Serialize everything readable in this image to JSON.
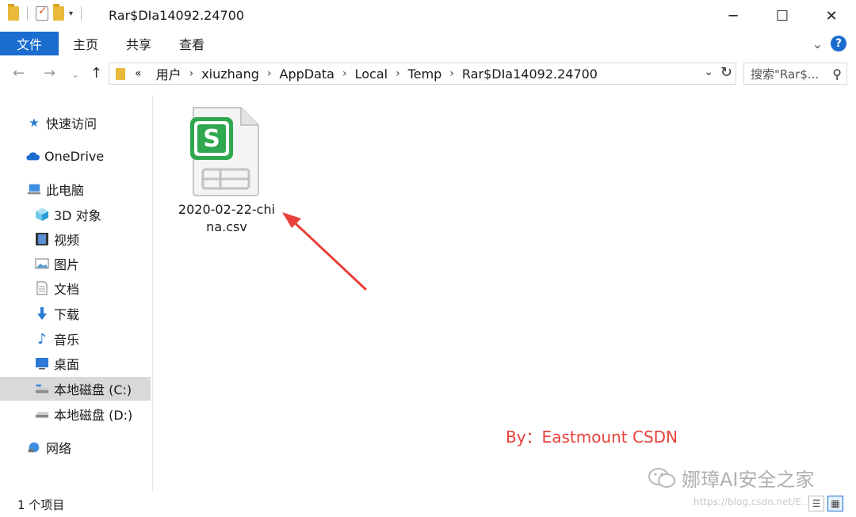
{
  "window": {
    "title": "Rar$DIa14092.24700"
  },
  "ribbon": {
    "tabs": [
      "文件",
      "主页",
      "共享",
      "查看"
    ]
  },
  "address": {
    "overflow": "«",
    "crumbs": [
      "用户",
      "xiuzhang",
      "AppData",
      "Local",
      "Temp",
      "Rar$DIa14092.24700"
    ],
    "search_placeholder": "搜索\"Rar$..."
  },
  "sidebar": {
    "items": [
      {
        "label": "快速访问",
        "icon": "star-icon"
      },
      {
        "label": "OneDrive",
        "icon": "cloud-icon"
      },
      {
        "label": "此电脑",
        "icon": "computer-icon"
      },
      {
        "label": "3D 对象",
        "icon": "cube-icon"
      },
      {
        "label": "视频",
        "icon": "video-icon"
      },
      {
        "label": "图片",
        "icon": "picture-icon"
      },
      {
        "label": "文档",
        "icon": "document-icon"
      },
      {
        "label": "下载",
        "icon": "download-icon"
      },
      {
        "label": "音乐",
        "icon": "music-icon"
      },
      {
        "label": "桌面",
        "icon": "desktop-icon"
      },
      {
        "label": "本地磁盘 (C:)",
        "icon": "drive-c-icon"
      },
      {
        "label": "本地磁盘 (D:)",
        "icon": "drive-d-icon"
      },
      {
        "label": "网络",
        "icon": "network-icon"
      }
    ],
    "selected": "本地磁盘 (C:)"
  },
  "files": [
    {
      "name_line1": "2020-02-22-chi",
      "name_line2": "na.csv",
      "icon": "spreadsheet-file-icon",
      "icon_letter": "S"
    }
  ],
  "status": {
    "item_count": "1 个项目"
  },
  "watermarks": {
    "author": "By：Eastmount CSDN",
    "wechat": "娜璋AI安全之家",
    "url": "https://blog.csdn.net/E..."
  },
  "colors": {
    "accent": "#1a6ccf",
    "spreadsheet_green": "#2fa84f",
    "arrow_red": "#e8403a",
    "selected_bg": "#d9d9d9"
  }
}
